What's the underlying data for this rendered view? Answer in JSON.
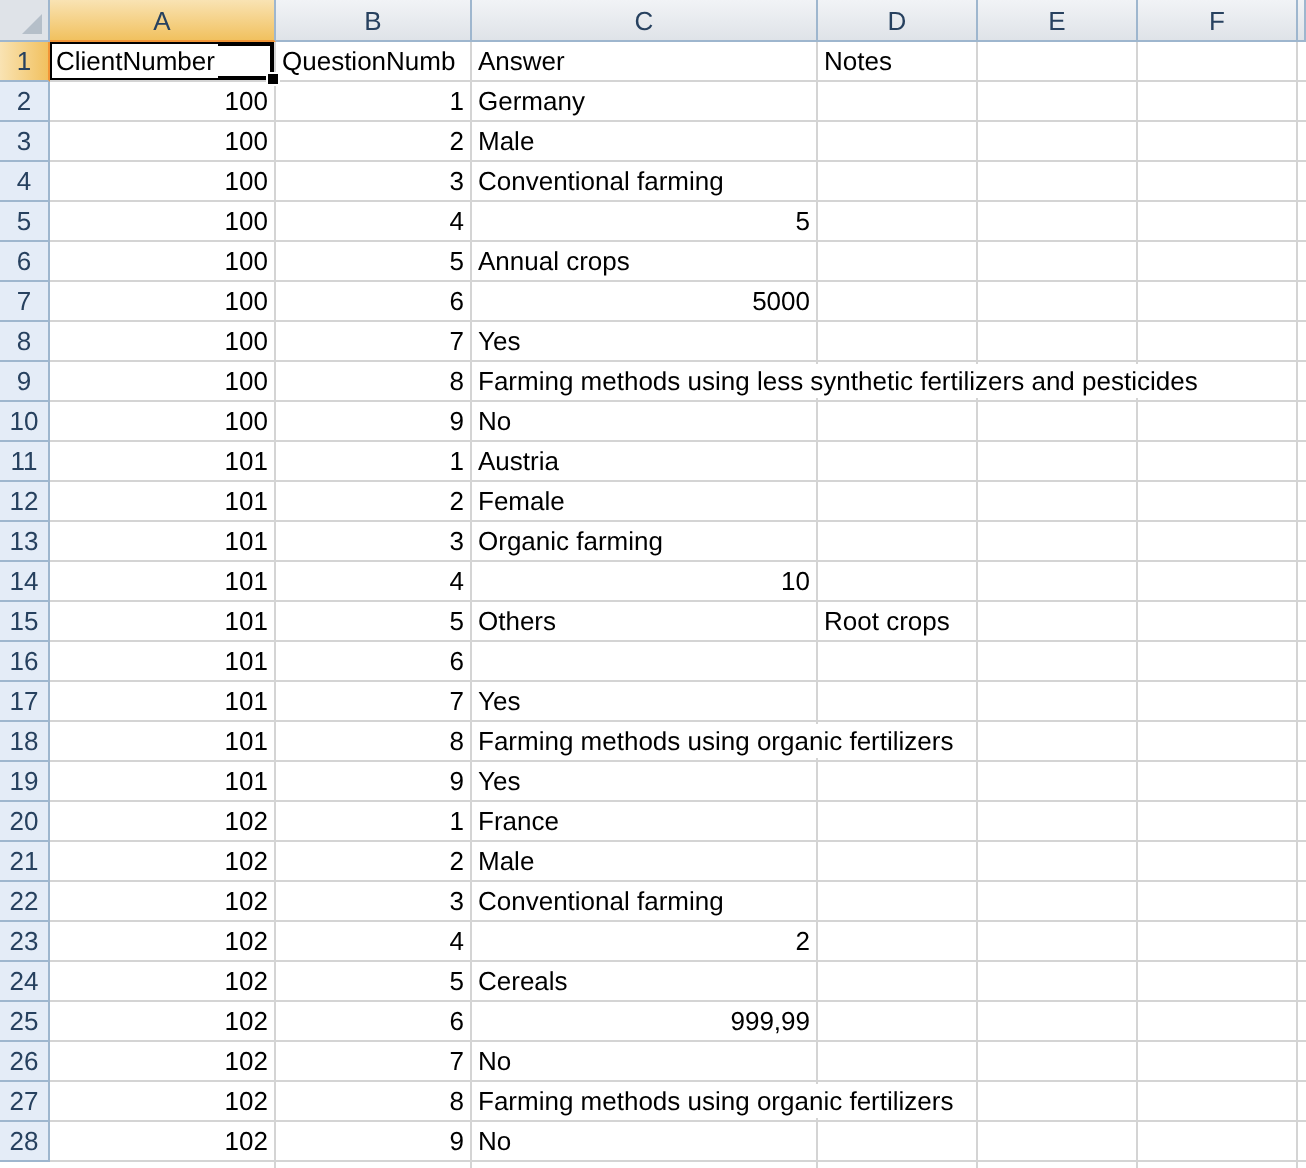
{
  "columns": [
    {
      "label": "A",
      "selected": true
    },
    {
      "label": "B",
      "selected": false
    },
    {
      "label": "C",
      "selected": false
    },
    {
      "label": "D",
      "selected": false
    },
    {
      "label": "E",
      "selected": false
    },
    {
      "label": "F",
      "selected": false
    }
  ],
  "rows": [
    {
      "number": "1",
      "selected": true,
      "A": {
        "text": "ClientNumber",
        "kind": "text",
        "selected": true
      },
      "B": {
        "text": "QuestionNumb",
        "kind": "text",
        "selected": false
      },
      "C": {
        "text": "Answer",
        "kind": "text",
        "selected": false
      },
      "D": {
        "text": "Notes",
        "kind": "text",
        "selected": false
      }
    },
    {
      "number": "2",
      "selected": false,
      "A": {
        "text": "100",
        "kind": "number",
        "selected": false
      },
      "B": {
        "text": "1",
        "kind": "number",
        "selected": false
      },
      "C": {
        "text": "Germany",
        "kind": "text",
        "selected": false
      }
    },
    {
      "number": "3",
      "selected": false,
      "A": {
        "text": "100",
        "kind": "number",
        "selected": false
      },
      "B": {
        "text": "2",
        "kind": "number",
        "selected": false
      },
      "C": {
        "text": "Male",
        "kind": "text",
        "selected": false
      }
    },
    {
      "number": "4",
      "selected": false,
      "A": {
        "text": "100",
        "kind": "number",
        "selected": false
      },
      "B": {
        "text": "3",
        "kind": "number",
        "selected": false
      },
      "C": {
        "text": "Conventional farming",
        "kind": "text",
        "selected": false
      }
    },
    {
      "number": "5",
      "selected": false,
      "A": {
        "text": "100",
        "kind": "number",
        "selected": false
      },
      "B": {
        "text": "4",
        "kind": "number",
        "selected": false
      },
      "C": {
        "text": "5",
        "kind": "number",
        "selected": false
      }
    },
    {
      "number": "6",
      "selected": false,
      "A": {
        "text": "100",
        "kind": "number",
        "selected": false
      },
      "B": {
        "text": "5",
        "kind": "number",
        "selected": false
      },
      "C": {
        "text": "Annual crops",
        "kind": "text",
        "selected": false
      }
    },
    {
      "number": "7",
      "selected": false,
      "A": {
        "text": "100",
        "kind": "number",
        "selected": false
      },
      "B": {
        "text": "6",
        "kind": "number",
        "selected": false
      },
      "C": {
        "text": "5000",
        "kind": "number",
        "selected": false
      }
    },
    {
      "number": "8",
      "selected": false,
      "A": {
        "text": "100",
        "kind": "number",
        "selected": false
      },
      "B": {
        "text": "7",
        "kind": "number",
        "selected": false
      },
      "C": {
        "text": "Yes",
        "kind": "text",
        "selected": false
      }
    },
    {
      "number": "9",
      "selected": false,
      "A": {
        "text": "100",
        "kind": "number",
        "selected": false
      },
      "B": {
        "text": "8",
        "kind": "number",
        "selected": false
      },
      "C": {
        "text": "Farming methods using less synthetic fertilizers and pesticides",
        "kind": "text",
        "selected": false
      }
    },
    {
      "number": "10",
      "selected": false,
      "A": {
        "text": "100",
        "kind": "number",
        "selected": false
      },
      "B": {
        "text": "9",
        "kind": "number",
        "selected": false
      },
      "C": {
        "text": "No",
        "kind": "text",
        "selected": false
      }
    },
    {
      "number": "11",
      "selected": false,
      "A": {
        "text": "101",
        "kind": "number",
        "selected": false
      },
      "B": {
        "text": "1",
        "kind": "number",
        "selected": false
      },
      "C": {
        "text": "Austria",
        "kind": "text",
        "selected": false
      }
    },
    {
      "number": "12",
      "selected": false,
      "A": {
        "text": "101",
        "kind": "number",
        "selected": false
      },
      "B": {
        "text": "2",
        "kind": "number",
        "selected": false
      },
      "C": {
        "text": "Female",
        "kind": "text",
        "selected": false
      }
    },
    {
      "number": "13",
      "selected": false,
      "A": {
        "text": "101",
        "kind": "number",
        "selected": false
      },
      "B": {
        "text": "3",
        "kind": "number",
        "selected": false
      },
      "C": {
        "text": "Organic farming",
        "kind": "text",
        "selected": false
      }
    },
    {
      "number": "14",
      "selected": false,
      "A": {
        "text": "101",
        "kind": "number",
        "selected": false
      },
      "B": {
        "text": "4",
        "kind": "number",
        "selected": false
      },
      "C": {
        "text": "10",
        "kind": "number",
        "selected": false
      }
    },
    {
      "number": "15",
      "selected": false,
      "A": {
        "text": "101",
        "kind": "number",
        "selected": false
      },
      "B": {
        "text": "5",
        "kind": "number",
        "selected": false
      },
      "C": {
        "text": "Others",
        "kind": "text",
        "selected": false
      },
      "D": {
        "text": "Root crops",
        "kind": "text",
        "selected": false
      }
    },
    {
      "number": "16",
      "selected": false,
      "A": {
        "text": "101",
        "kind": "number",
        "selected": false
      },
      "B": {
        "text": "6",
        "kind": "number",
        "selected": false
      }
    },
    {
      "number": "17",
      "selected": false,
      "A": {
        "text": "101",
        "kind": "number",
        "selected": false
      },
      "B": {
        "text": "7",
        "kind": "number",
        "selected": false
      },
      "C": {
        "text": "Yes",
        "kind": "text",
        "selected": false
      }
    },
    {
      "number": "18",
      "selected": false,
      "A": {
        "text": "101",
        "kind": "number",
        "selected": false
      },
      "B": {
        "text": "8",
        "kind": "number",
        "selected": false
      },
      "C": {
        "text": "Farming methods using organic fertilizers",
        "kind": "text",
        "selected": false
      }
    },
    {
      "number": "19",
      "selected": false,
      "A": {
        "text": "101",
        "kind": "number",
        "selected": false
      },
      "B": {
        "text": "9",
        "kind": "number",
        "selected": false
      },
      "C": {
        "text": "Yes",
        "kind": "text",
        "selected": false
      }
    },
    {
      "number": "20",
      "selected": false,
      "A": {
        "text": "102",
        "kind": "number",
        "selected": false
      },
      "B": {
        "text": "1",
        "kind": "number",
        "selected": false
      },
      "C": {
        "text": "France",
        "kind": "text",
        "selected": false
      }
    },
    {
      "number": "21",
      "selected": false,
      "A": {
        "text": "102",
        "kind": "number",
        "selected": false
      },
      "B": {
        "text": "2",
        "kind": "number",
        "selected": false
      },
      "C": {
        "text": "Male",
        "kind": "text",
        "selected": false
      }
    },
    {
      "number": "22",
      "selected": false,
      "A": {
        "text": "102",
        "kind": "number",
        "selected": false
      },
      "B": {
        "text": "3",
        "kind": "number",
        "selected": false
      },
      "C": {
        "text": "Conventional farming",
        "kind": "text",
        "selected": false
      }
    },
    {
      "number": "23",
      "selected": false,
      "A": {
        "text": "102",
        "kind": "number",
        "selected": false
      },
      "B": {
        "text": "4",
        "kind": "number",
        "selected": false
      },
      "C": {
        "text": "2",
        "kind": "number",
        "selected": false
      }
    },
    {
      "number": "24",
      "selected": false,
      "A": {
        "text": "102",
        "kind": "number",
        "selected": false
      },
      "B": {
        "text": "5",
        "kind": "number",
        "selected": false
      },
      "C": {
        "text": "Cereals",
        "kind": "text",
        "selected": false
      }
    },
    {
      "number": "25",
      "selected": false,
      "A": {
        "text": "102",
        "kind": "number",
        "selected": false
      },
      "B": {
        "text": "6",
        "kind": "number",
        "selected": false
      },
      "C": {
        "text": "999,99",
        "kind": "number",
        "selected": false
      }
    },
    {
      "number": "26",
      "selected": false,
      "A": {
        "text": "102",
        "kind": "number",
        "selected": false
      },
      "B": {
        "text": "7",
        "kind": "number",
        "selected": false
      },
      "C": {
        "text": "No",
        "kind": "text",
        "selected": false
      }
    },
    {
      "number": "27",
      "selected": false,
      "A": {
        "text": "102",
        "kind": "number",
        "selected": false
      },
      "B": {
        "text": "8",
        "kind": "number",
        "selected": false
      },
      "C": {
        "text": "Farming methods using organic fertilizers",
        "kind": "text",
        "selected": false
      }
    },
    {
      "number": "28",
      "selected": false,
      "A": {
        "text": "102",
        "kind": "number",
        "selected": false
      },
      "B": {
        "text": "9",
        "kind": "number",
        "selected": false
      },
      "C": {
        "text": "No",
        "kind": "text",
        "selected": false
      }
    }
  ]
}
